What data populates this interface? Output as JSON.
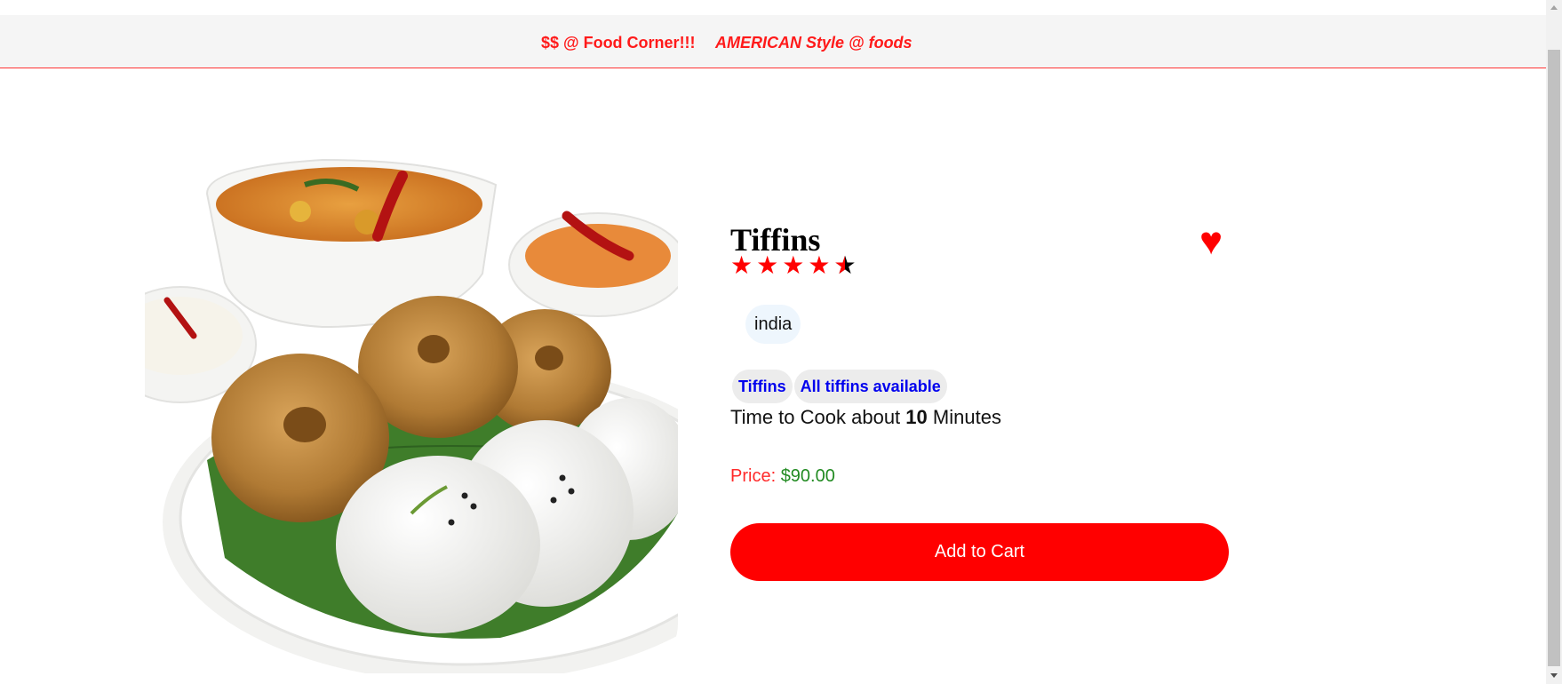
{
  "header": {
    "link_1": "$$ @ Food Corner!!!",
    "link_2": "AMERICAN Style @ foods"
  },
  "food": {
    "name": "Tiffins",
    "rating": 4.5,
    "rating_max": 5,
    "origin": "india",
    "tags": [
      "Tiffins",
      "All tiffins available"
    ],
    "cook_time_prefix": "Time to Cook about",
    "cook_time_value": "10",
    "cook_time_suffix": "Minutes",
    "price_label": "Price:",
    "price_value": "$90.00",
    "favorite": true
  },
  "actions": {
    "add_to_cart": "Add to Cart"
  },
  "icons": {
    "star": "star-icon",
    "heart": "heart-icon"
  },
  "colors": {
    "accent": "#ff0000",
    "price": "#228b22",
    "tag_text": "#0000ee"
  }
}
